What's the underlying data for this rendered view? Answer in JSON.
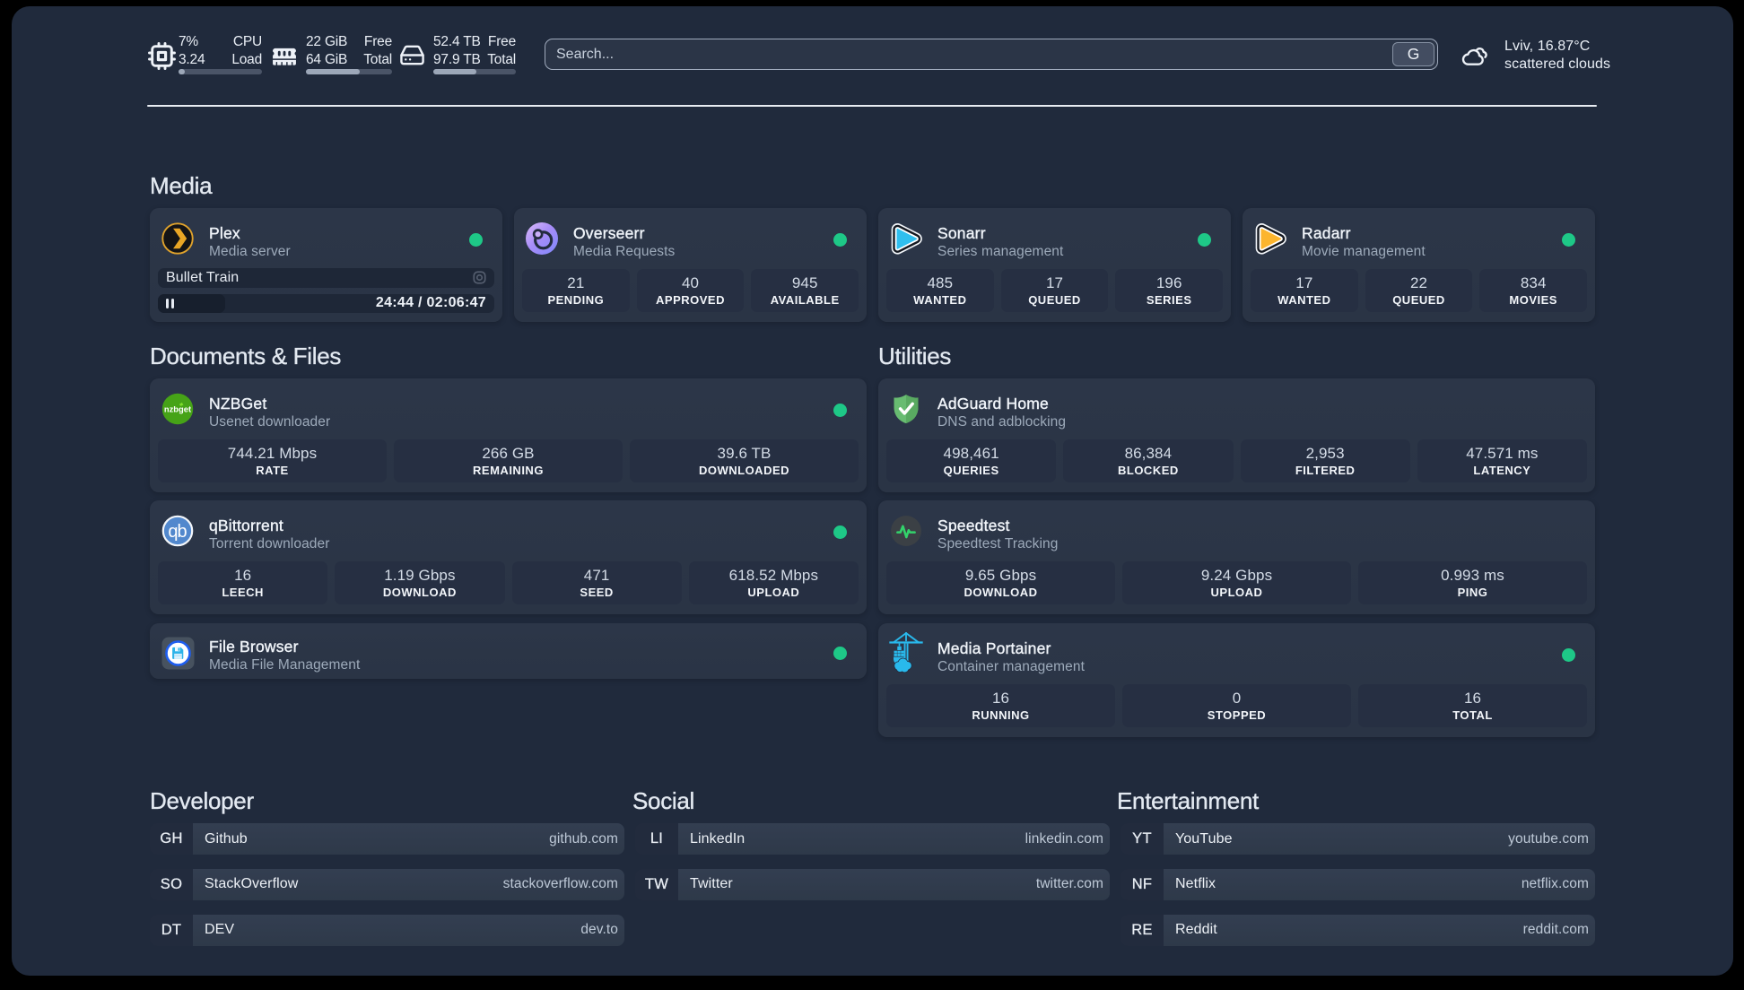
{
  "header": {
    "resources": [
      {
        "icon": "cpu-icon",
        "cells": [
          {
            "v": "7%",
            "l": "CPU"
          },
          {
            "v": "3.24",
            "l": "Load"
          }
        ],
        "progress_pct": 8
      },
      {
        "icon": "memory-icon",
        "cells": [
          {
            "v": "22 GiB",
            "l": "Free"
          },
          {
            "v": "64 GiB",
            "l": "Total"
          }
        ],
        "progress_pct": 63
      },
      {
        "icon": "hard-drive-icon",
        "cells": [
          {
            "v": "52.4 TB",
            "l": "Free"
          },
          {
            "v": "97.9 TB",
            "l": "Total"
          }
        ],
        "progress_pct": 52
      }
    ],
    "search": {
      "placeholder": "Search...",
      "button_label": "G"
    },
    "weather": {
      "line1": "Lviv, 16.87°C",
      "line2": "scattered clouds"
    }
  },
  "sections": {
    "media": {
      "title": "Media",
      "plex": {
        "title": "Plex",
        "subtitle": "Media server",
        "now_playing": "Bullet Train",
        "time": "24:44 / 02:06:47",
        "progress_pct": 20
      },
      "overseerr": {
        "title": "Overseerr",
        "subtitle": "Media Requests",
        "stats": [
          {
            "value": "21",
            "label": "PENDING"
          },
          {
            "value": "40",
            "label": "APPROVED"
          },
          {
            "value": "945",
            "label": "AVAILABLE"
          }
        ]
      },
      "sonarr": {
        "title": "Sonarr",
        "subtitle": "Series management",
        "stats": [
          {
            "value": "485",
            "label": "WANTED"
          },
          {
            "value": "17",
            "label": "QUEUED"
          },
          {
            "value": "196",
            "label": "SERIES"
          }
        ]
      },
      "radarr": {
        "title": "Radarr",
        "subtitle": "Movie management",
        "stats": [
          {
            "value": "17",
            "label": "WANTED"
          },
          {
            "value": "22",
            "label": "QUEUED"
          },
          {
            "value": "834",
            "label": "MOVIES"
          }
        ]
      }
    },
    "documents": {
      "title": "Documents & Files",
      "nzbget": {
        "title": "NZBGet",
        "subtitle": "Usenet downloader",
        "stats": [
          {
            "value": "744.21 Mbps",
            "label": "RATE"
          },
          {
            "value": "266 GB",
            "label": "REMAINING"
          },
          {
            "value": "39.6 TB",
            "label": "DOWNLOADED"
          }
        ]
      },
      "qbittorrent": {
        "title": "qBittorrent",
        "subtitle": "Torrent downloader",
        "stats": [
          {
            "value": "16",
            "label": "LEECH"
          },
          {
            "value": "1.19 Gbps",
            "label": "DOWNLOAD"
          },
          {
            "value": "471",
            "label": "SEED"
          },
          {
            "value": "618.52 Mbps",
            "label": "UPLOAD"
          }
        ]
      },
      "filebrowser": {
        "title": "File Browser",
        "subtitle": "Media File Management"
      }
    },
    "utilities": {
      "title": "Utilities",
      "adguard": {
        "title": "AdGuard Home",
        "subtitle": "DNS and adblocking",
        "stats": [
          {
            "value": "498,461",
            "label": "QUERIES"
          },
          {
            "value": "86,384",
            "label": "BLOCKED"
          },
          {
            "value": "2,953",
            "label": "FILTERED"
          },
          {
            "value": "47.571 ms",
            "label": "LATENCY"
          }
        ]
      },
      "speedtest": {
        "title": "Speedtest",
        "subtitle": "Speedtest Tracking",
        "stats": [
          {
            "value": "9.65 Gbps",
            "label": "DOWNLOAD"
          },
          {
            "value": "9.24 Gbps",
            "label": "UPLOAD"
          },
          {
            "value": "0.993 ms",
            "label": "PING"
          }
        ]
      },
      "portainer": {
        "title": "Media Portainer",
        "subtitle": "Container management",
        "stats": [
          {
            "value": "16",
            "label": "RUNNING"
          },
          {
            "value": "0",
            "label": "STOPPED"
          },
          {
            "value": "16",
            "label": "TOTAL"
          }
        ]
      }
    }
  },
  "bookmarks": [
    {
      "title": "Developer",
      "items": [
        {
          "abbr": "GH",
          "name": "Github",
          "url": "github.com"
        },
        {
          "abbr": "SO",
          "name": "StackOverflow",
          "url": "stackoverflow.com"
        },
        {
          "abbr": "DT",
          "name": "DEV",
          "url": "dev.to"
        }
      ]
    },
    {
      "title": "Social",
      "items": [
        {
          "abbr": "LI",
          "name": "LinkedIn",
          "url": "linkedin.com"
        },
        {
          "abbr": "TW",
          "name": "Twitter",
          "url": "twitter.com"
        }
      ]
    },
    {
      "title": "Entertainment",
      "items": [
        {
          "abbr": "YT",
          "name": "YouTube",
          "url": "youtube.com"
        },
        {
          "abbr": "NF",
          "name": "Netflix",
          "url": "netflix.com"
        },
        {
          "abbr": "RE",
          "name": "Reddit",
          "url": "reddit.com"
        }
      ]
    }
  ]
}
